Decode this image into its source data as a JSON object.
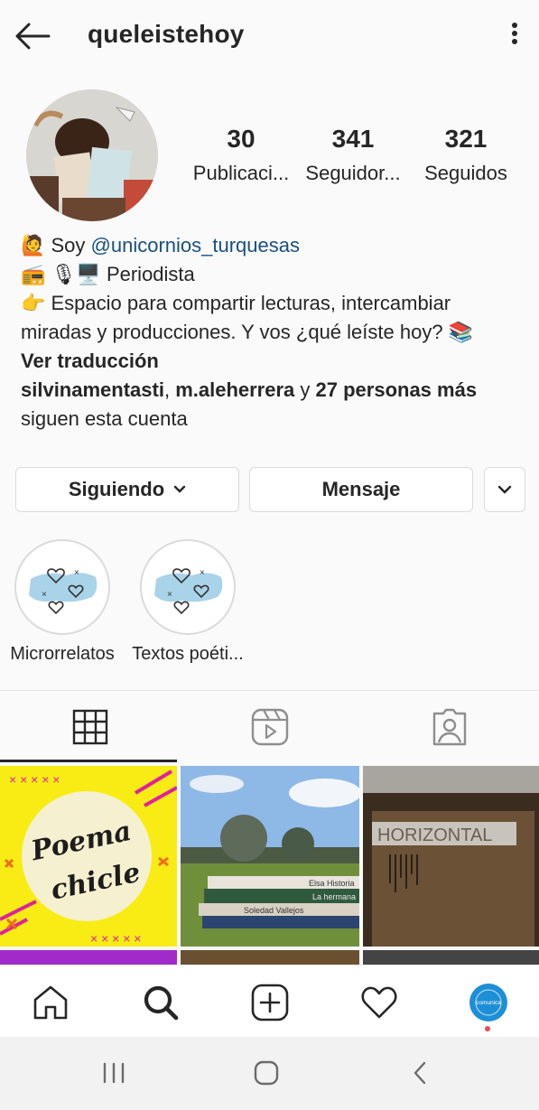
{
  "header": {
    "username": "queleistehoy",
    "back_icon": "arrow-left-icon",
    "menu_icon": "more-vertical-icon"
  },
  "profile": {
    "stats": [
      {
        "value": "30",
        "label": "Publicaci..."
      },
      {
        "value": "341",
        "label": "Seguidor..."
      },
      {
        "value": "321",
        "label": "Seguidos"
      }
    ]
  },
  "bio": {
    "line1_prefix": "🙋 Soy ",
    "line1_mention": "@unicornios_turquesas",
    "line2": "📻 🎙🖥️ Periodista",
    "line3": "👉 Espacio para compartir lecturas, intercambiar",
    "line4": "miradas y producciones. Y vos ¿qué leíste hoy? 📚",
    "translate": "Ver traducción",
    "followers_user1": "silvinamentasti",
    "followers_sep": ", ",
    "followers_user2": "m.aleherrera",
    "followers_and": " y ",
    "followers_more": "27 personas más",
    "followers_suffix": "siguen esta cuenta"
  },
  "buttons": {
    "following": "Siguiendo",
    "message": "Mensaje"
  },
  "highlights": [
    {
      "label": "Microrrelatos"
    },
    {
      "label": "Textos poéti..."
    }
  ],
  "grid": {
    "cell1_text_line1": "Poema",
    "cell1_text_line2": "chicle",
    "cell2_book1": "Elsa Historia",
    "cell2_book2": "La hermana",
    "cell2_book3": "Soledad Vallejos",
    "cell3_text": "HORIZONTAL"
  },
  "avatar_badge": "comunica",
  "colors": {
    "mention": "#1a4f86",
    "accent_dot": "#ed4956",
    "avatar_bg": "#1e8fd6"
  }
}
